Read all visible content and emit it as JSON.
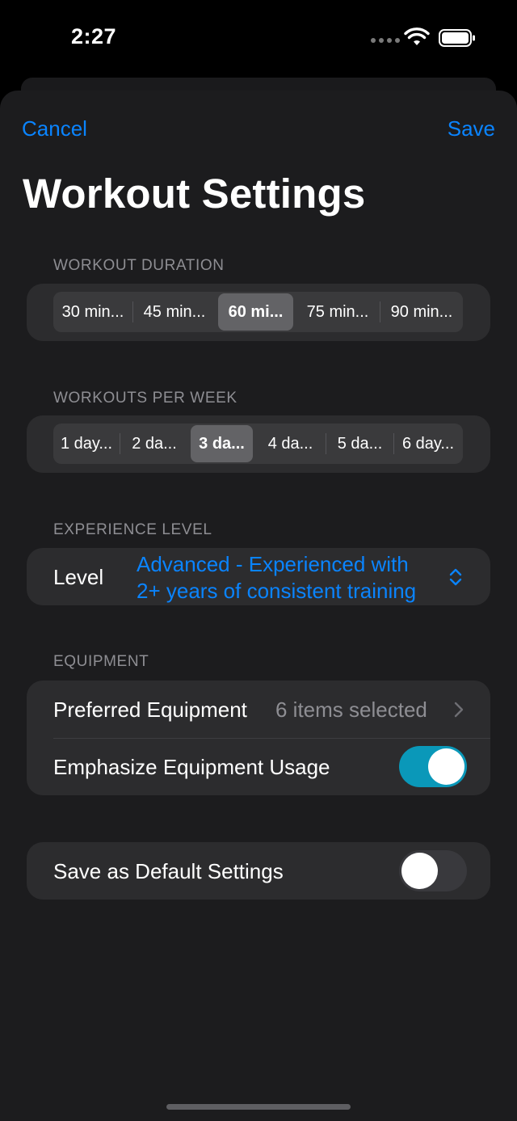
{
  "status_bar": {
    "time": "2:27"
  },
  "nav": {
    "cancel_label": "Cancel",
    "save_label": "Save"
  },
  "title": "Workout Settings",
  "duration": {
    "header": "WORKOUT DURATION",
    "options": [
      "30 min...",
      "45 min...",
      "60 mi...",
      "75 min...",
      "90 min..."
    ],
    "selected_index": 2
  },
  "per_week": {
    "header": "WORKOUTS PER WEEK",
    "options": [
      "1 day...",
      "2 da...",
      "3 da...",
      "4 da...",
      "5 da...",
      "6 day..."
    ],
    "selected_index": 2
  },
  "experience": {
    "header": "EXPERIENCE LEVEL",
    "label": "Level",
    "value_line1": "Advanced - Experienced with",
    "value_line2": "2+ years of consistent training"
  },
  "equipment": {
    "header": "EQUIPMENT",
    "preferred_label": "Preferred Equipment",
    "preferred_value": "6 items selected",
    "emphasize_label": "Emphasize Equipment Usage",
    "emphasize_on": true
  },
  "defaults": {
    "label": "Save as Default Settings",
    "on": false
  },
  "colors": {
    "accent": "#0a84ff",
    "toggle_on": "#0a98b9",
    "background": "#1c1c1e",
    "group": "#2c2c2e"
  }
}
